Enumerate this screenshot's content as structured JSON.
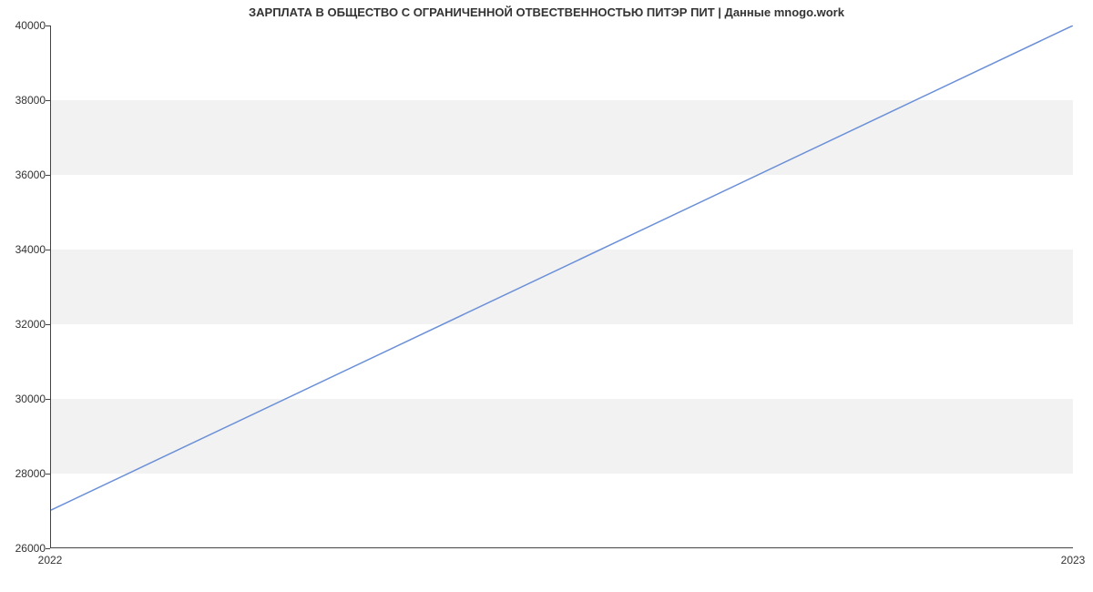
{
  "chart_data": {
    "type": "line",
    "title": "ЗАРПЛАТА В ОБЩЕСТВО С ОГРАНИЧЕННОЙ ОТВЕСТВЕННОСТЬЮ ПИТЭР ПИТ | Данные mnogo.work",
    "xlabel": "",
    "ylabel": "",
    "x": [
      2022,
      2023
    ],
    "values": [
      27000,
      40000
    ],
    "x_ticks": [
      "2022",
      "2023"
    ],
    "y_ticks": [
      26000,
      28000,
      30000,
      32000,
      34000,
      36000,
      38000,
      40000
    ],
    "xlim": [
      2022,
      2023
    ],
    "ylim": [
      26000,
      40000
    ]
  }
}
